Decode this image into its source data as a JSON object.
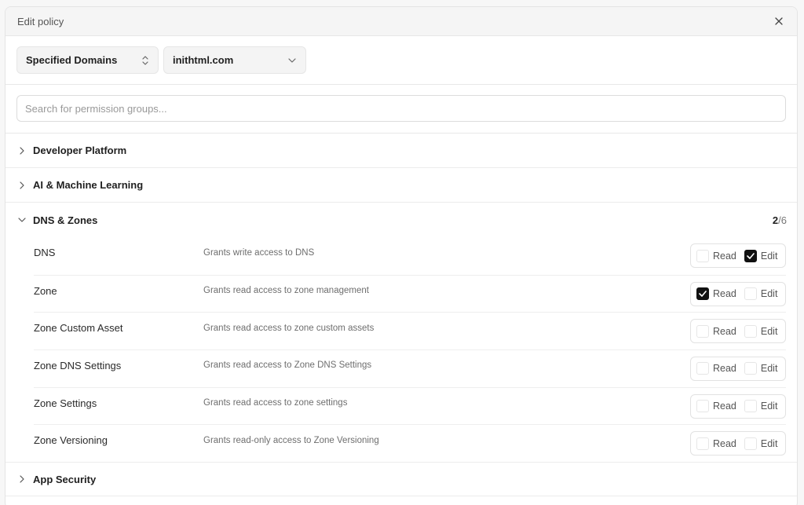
{
  "modal": {
    "title": "Edit policy"
  },
  "filters": {
    "scope_value": "Specified Domains",
    "domain_value": "inithtml.com"
  },
  "search": {
    "placeholder": "Search for permission groups..."
  },
  "groups": [
    {
      "label": "Developer Platform",
      "expanded": false
    },
    {
      "label": "AI & Machine Learning",
      "expanded": false
    },
    {
      "label": "DNS & Zones",
      "expanded": true,
      "count_selected": "2",
      "count_separator": "/",
      "count_total": "6"
    },
    {
      "label": "App Security",
      "expanded": false
    }
  ],
  "permissions": [
    {
      "name": "DNS",
      "description": "Grants write access to DNS",
      "read": false,
      "edit": true
    },
    {
      "name": "Zone",
      "description": "Grants read access to zone management",
      "read": true,
      "edit": false
    },
    {
      "name": "Zone Custom Asset",
      "description": "Grants read access to zone custom assets",
      "read": false,
      "edit": false
    },
    {
      "name": "Zone DNS Settings",
      "description": "Grants read access to Zone DNS Settings",
      "read": false,
      "edit": false
    },
    {
      "name": "Zone Settings",
      "description": "Grants read access to zone settings",
      "read": false,
      "edit": false
    },
    {
      "name": "Zone Versioning",
      "description": "Grants read-only access to Zone Versioning",
      "read": false,
      "edit": false
    }
  ],
  "labels": {
    "read": "Read",
    "edit": "Edit"
  },
  "icons": {
    "close": "close-icon",
    "updown": "chevron-up-down-icon",
    "dropdown": "chevron-down-icon",
    "collapsed": "chevron-right-icon",
    "expanded": "chevron-down-icon",
    "check": "check-icon"
  },
  "colors": {
    "checked_bg": "#111111",
    "header_bg": "#f5f5f5"
  }
}
